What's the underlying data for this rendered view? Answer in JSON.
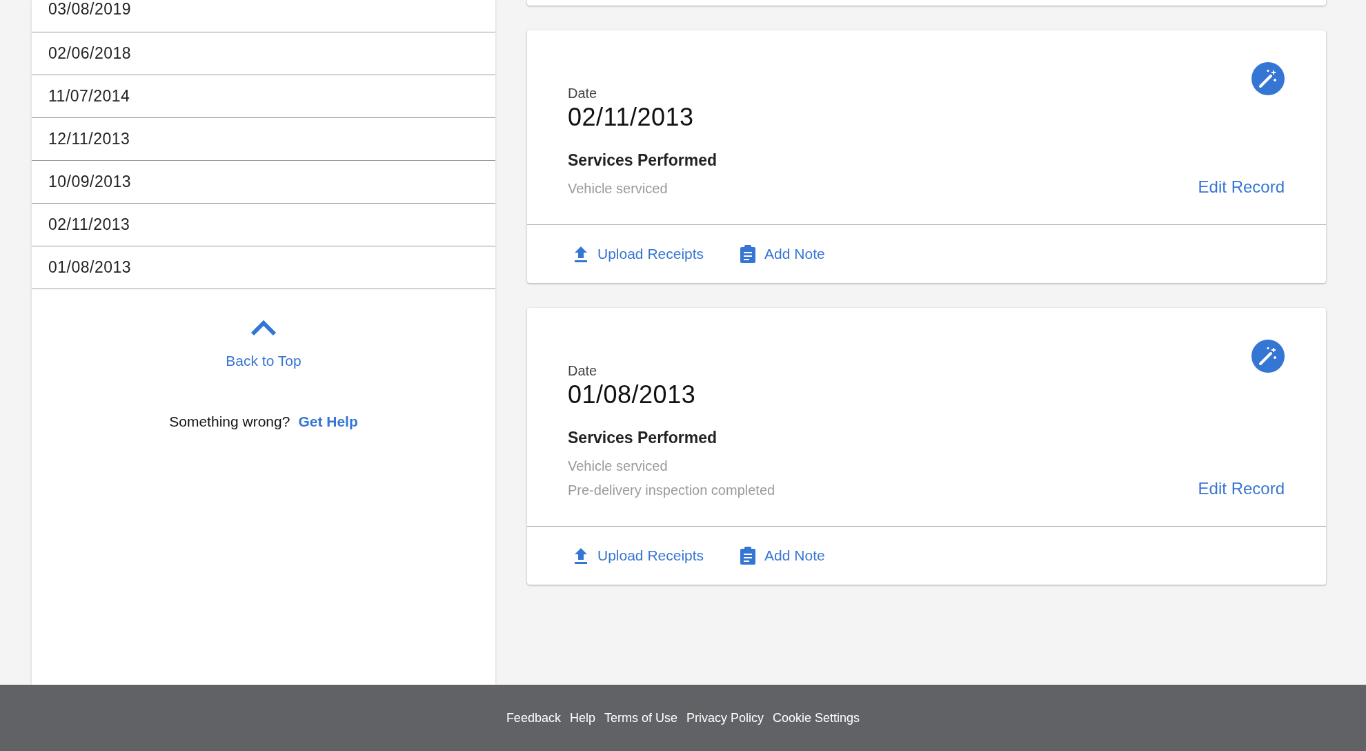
{
  "sidebar": {
    "dates": [
      {
        "label": "03/08/2019"
      },
      {
        "label": "02/06/2018"
      },
      {
        "label": "11/07/2014"
      },
      {
        "label": "12/11/2013"
      },
      {
        "label": "10/09/2013"
      },
      {
        "label": "02/11/2013"
      },
      {
        "label": "01/08/2013"
      }
    ],
    "back_to_top": "Back to Top",
    "help_prompt": "Something wrong?",
    "help_link": "Get Help"
  },
  "records": [
    {
      "date_label": "Date",
      "date": "02/11/2013",
      "services_title": "Services Performed",
      "services": [
        "Vehicle serviced"
      ],
      "edit": "Edit Record",
      "upload": "Upload Receipts",
      "note": "Add Note"
    },
    {
      "date_label": "Date",
      "date": "01/08/2013",
      "services_title": "Services Performed",
      "services": [
        "Vehicle serviced",
        "Pre-delivery inspection completed"
      ],
      "edit": "Edit Record",
      "upload": "Upload Receipts",
      "note": "Add Note"
    }
  ],
  "footer": {
    "links": [
      "Feedback",
      "Help",
      "Terms of Use",
      "Privacy Policy",
      "Cookie Settings"
    ]
  }
}
